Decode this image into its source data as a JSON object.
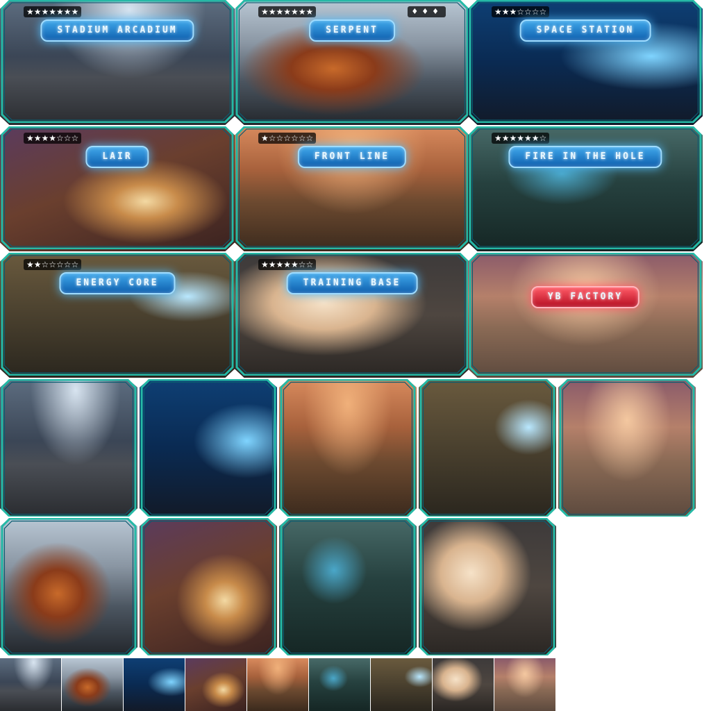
{
  "colors": {
    "frame": "#25b9a6",
    "frame_dark": "#0b5d72",
    "title_blue": "#1b7fd0",
    "title_red": "#d01a2e"
  },
  "levels": [
    {
      "title": "Stadium Arcadium",
      "stars": "★★★★★★★",
      "gems": "",
      "scene": "stadium"
    },
    {
      "title": "Serpent",
      "stars": "★★★★★★★",
      "gems": "♦♦♦",
      "scene": "serpent"
    },
    {
      "title": "Space Station",
      "stars": "★★★☆☆☆☆",
      "gems": "",
      "scene": "station"
    },
    {
      "title": "Lair",
      "stars": "★★★★☆☆☆",
      "gems": "",
      "scene": "lair"
    },
    {
      "title": "Front Line",
      "stars": "★☆☆☆☆☆☆",
      "gems": "",
      "scene": "frontline"
    },
    {
      "title": "Fire in the Hole",
      "stars": "★★★★★★☆",
      "gems": "",
      "scene": "fire"
    },
    {
      "title": "Energy Core",
      "stars": "★★☆☆☆☆☆",
      "gems": "",
      "scene": "energy"
    },
    {
      "title": "Training Base",
      "stars": "★★★★★☆☆",
      "gems": "",
      "scene": "training"
    },
    {
      "title": "YB Factory",
      "stars": "",
      "gems": "",
      "scene": "factory",
      "accent": "red"
    }
  ],
  "previews_row1": [
    "stadium",
    "station",
    "frontline",
    "energy",
    "factory"
  ],
  "previews_row2": [
    "serpent",
    "lair",
    "fire",
    "training"
  ],
  "thumbnails": [
    "stadium",
    "serpent",
    "station",
    "lair",
    "frontline",
    "fire",
    "energy",
    "training",
    "factory"
  ]
}
